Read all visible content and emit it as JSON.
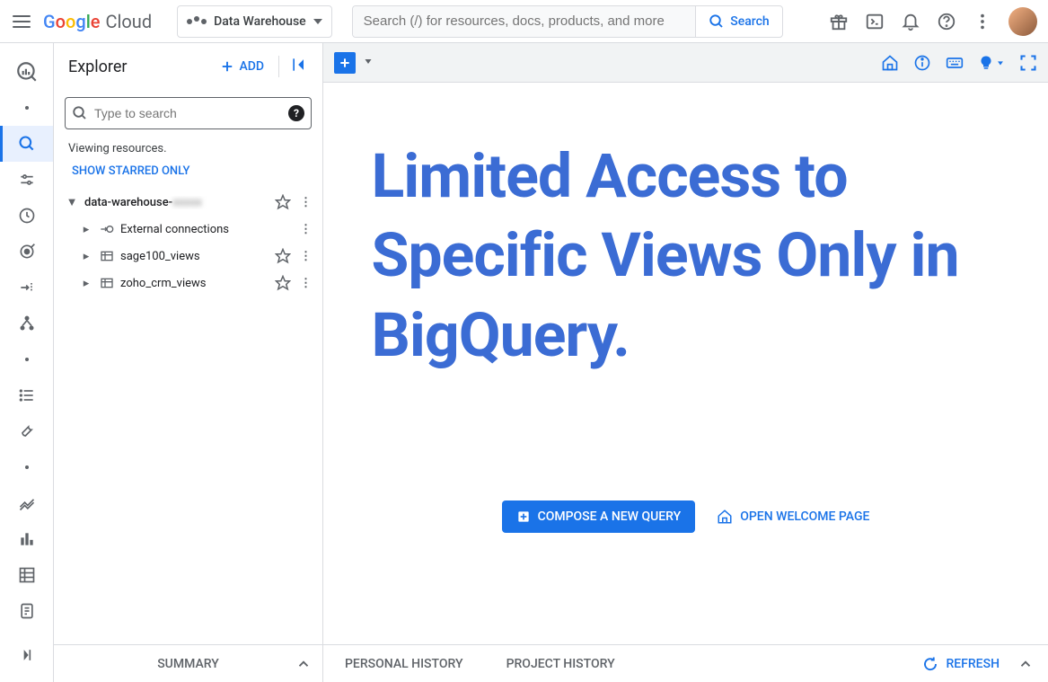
{
  "header": {
    "logo_cloud": "Cloud",
    "project_name": "Data Warehouse",
    "search_placeholder": "Search (/) for resources, docs, products, and more",
    "search_button": "Search"
  },
  "explorer": {
    "title": "Explorer",
    "add_label": "ADD",
    "search_placeholder": "Type to search",
    "viewing_text": "Viewing resources.",
    "starred_link": "SHOW STARRED ONLY",
    "project_label": "data-warehouse-",
    "items": [
      {
        "label": "External connections",
        "has_star": false
      },
      {
        "label": "sage100_views",
        "has_star": true
      },
      {
        "label": "zoho_crm_views",
        "has_star": true
      }
    ]
  },
  "content": {
    "headline": "Limited Access to Specific Views Only in BigQuery.",
    "compose_label": "COMPOSE A NEW QUERY",
    "welcome_label": "OPEN WELCOME PAGE"
  },
  "bottom": {
    "summary": "SUMMARY",
    "personal_history": "PERSONAL HISTORY",
    "project_history": "PROJECT HISTORY",
    "refresh": "REFRESH"
  }
}
